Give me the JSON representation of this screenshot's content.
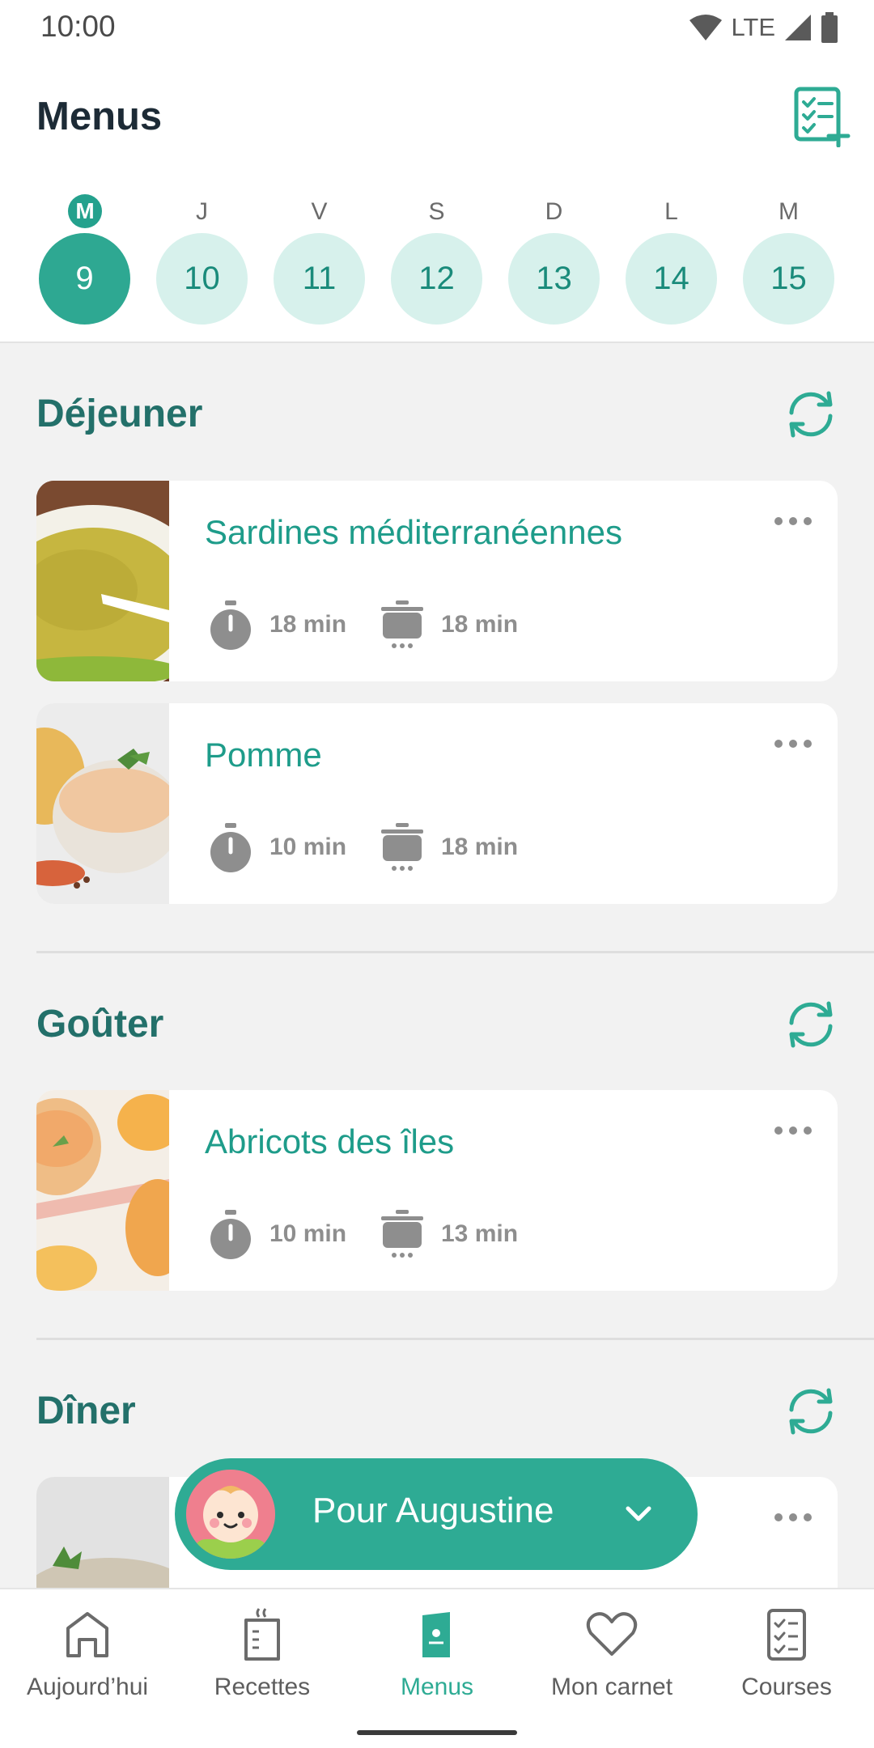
{
  "status_bar": {
    "time": "10:00",
    "network": "LTE"
  },
  "header": {
    "title": "Menus",
    "add_icon": "checklist-add-icon"
  },
  "days": [
    {
      "letter": "M",
      "number": "9",
      "active": true
    },
    {
      "letter": "J",
      "number": "10",
      "active": false
    },
    {
      "letter": "V",
      "number": "11",
      "active": false
    },
    {
      "letter": "S",
      "number": "12",
      "active": false
    },
    {
      "letter": "D",
      "number": "13",
      "active": false
    },
    {
      "letter": "L",
      "number": "14",
      "active": false
    },
    {
      "letter": "M",
      "number": "15",
      "active": false
    }
  ],
  "sections": [
    {
      "title": "Déjeuner",
      "recipes": [
        {
          "title": "Sardines méditerranéennes",
          "prep_time": "18 min",
          "cook_time": "18 min"
        },
        {
          "title": "Pomme",
          "prep_time": "10 min",
          "cook_time": "18 min"
        }
      ]
    },
    {
      "title": "Goûter",
      "recipes": [
        {
          "title": "Abricots des îles",
          "prep_time": "10 min",
          "cook_time": "13 min"
        }
      ]
    },
    {
      "title": "Dîner",
      "recipes": [
        {
          "title": "",
          "prep_time": "",
          "cook_time": ""
        }
      ]
    }
  ],
  "fab": {
    "label": "Pour Augustine"
  },
  "bottom_nav": [
    {
      "label": "Aujourd’hui",
      "icon": "home-icon"
    },
    {
      "label": "Recettes",
      "icon": "recipe-icon"
    },
    {
      "label": "Menus",
      "icon": "menu-book-icon",
      "active": true
    },
    {
      "label": "Mon carnet",
      "icon": "heart-icon"
    },
    {
      "label": "Courses",
      "icon": "checklist-icon"
    }
  ],
  "colors": {
    "accent": "#2eab94",
    "accent_dark": "#23706a",
    "day_bg": "#d7f1ec",
    "background": "#f2f2f2"
  }
}
